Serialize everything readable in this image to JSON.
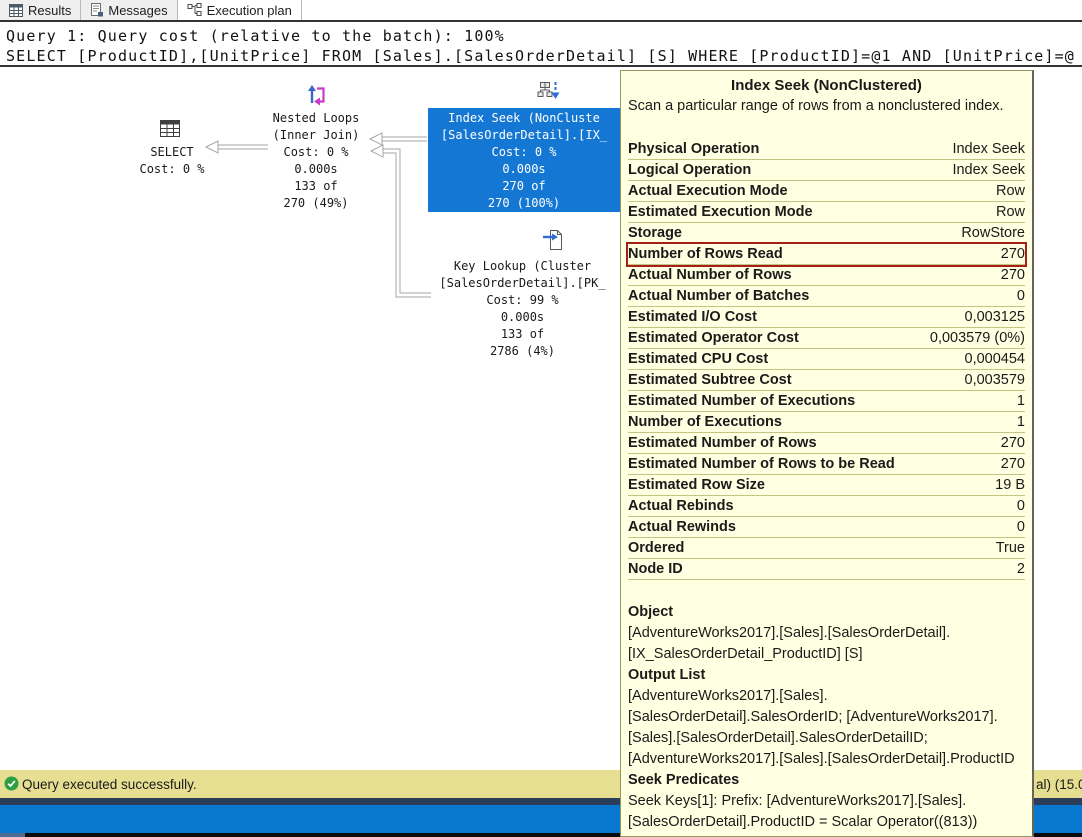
{
  "tabs": [
    {
      "label": "Results"
    },
    {
      "label": "Messages"
    },
    {
      "label": "Execution plan"
    }
  ],
  "query_header": {
    "line1": "Query 1: Query cost (relative to the batch): 100%",
    "line2": "SELECT [ProductID],[UnitPrice] FROM [Sales].[SalesOrderDetail] [S] WHERE [ProductID]=@1 AND [UnitPrice]=@"
  },
  "plan": {
    "nodes": {
      "select": {
        "lines": [
          "SELECT",
          "Cost: 0 %"
        ]
      },
      "nested_loops": {
        "lines": [
          "Nested Loops",
          "(Inner Join)",
          "Cost: 0 %",
          "0.000s",
          "133 of",
          "270 (49%)"
        ]
      },
      "index_seek": {
        "lines": [
          "Index Seek (NonCluste",
          "[SalesOrderDetail].[IX_",
          "Cost: 0 %",
          "0.000s",
          "270 of",
          "270 (100%)"
        ]
      },
      "key_lookup": {
        "lines": [
          "Key Lookup (Cluster",
          "[SalesOrderDetail].[PK_",
          "Cost: 99 %",
          "0.000s",
          "133 of",
          "2786 (4%)"
        ]
      }
    }
  },
  "tooltip": {
    "title": "Index Seek (NonClustered)",
    "description": "Scan a particular range of rows from a nonclustered index.",
    "rows": [
      {
        "label": "Physical Operation",
        "value": "Index Seek"
      },
      {
        "label": "Logical Operation",
        "value": "Index Seek"
      },
      {
        "label": "Actual Execution Mode",
        "value": "Row"
      },
      {
        "label": "Estimated Execution Mode",
        "value": "Row"
      },
      {
        "label": "Storage",
        "value": "RowStore"
      },
      {
        "label": "Number of Rows Read",
        "value": "270",
        "highlight": true
      },
      {
        "label": "Actual Number of Rows",
        "value": "270"
      },
      {
        "label": "Actual Number of Batches",
        "value": "0"
      },
      {
        "label": "Estimated I/O Cost",
        "value": "0,003125"
      },
      {
        "label": "Estimated Operator Cost",
        "value": "0,003579 (0%)"
      },
      {
        "label": "Estimated CPU Cost",
        "value": "0,000454"
      },
      {
        "label": "Estimated Subtree Cost",
        "value": "0,003579"
      },
      {
        "label": "Estimated Number of Executions",
        "value": "1"
      },
      {
        "label": "Number of Executions",
        "value": "1"
      },
      {
        "label": "Estimated Number of Rows",
        "value": "270"
      },
      {
        "label": "Estimated Number of Rows to be Read",
        "value": "270"
      },
      {
        "label": "Estimated Row Size",
        "value": "19 B"
      },
      {
        "label": "Actual Rebinds",
        "value": "0"
      },
      {
        "label": "Actual Rewinds",
        "value": "0"
      },
      {
        "label": "Ordered",
        "value": "True"
      },
      {
        "label": "Node ID",
        "value": "2"
      }
    ],
    "object_section": {
      "heading": "Object",
      "lines": [
        "[AdventureWorks2017].[Sales].[SalesOrderDetail].",
        "[IX_SalesOrderDetail_ProductID] [S]"
      ]
    },
    "output_list_section": {
      "heading": "Output List",
      "lines": [
        "[AdventureWorks2017].[Sales].",
        "[SalesOrderDetail].SalesOrderID; [AdventureWorks2017].",
        "[Sales].[SalesOrderDetail].SalesOrderDetailID;",
        "[AdventureWorks2017].[Sales].[SalesOrderDetail].ProductID"
      ]
    },
    "seek_predicates_section": {
      "heading": "Seek Predicates",
      "lines": [
        "Seek Keys[1]: Prefix: [AdventureWorks2017].[Sales].",
        "[SalesOrderDetail].ProductID = Scalar Operator((813))"
      ]
    }
  },
  "status_bar": {
    "message": "Query executed successfully.",
    "right_fragment": "al) (15.0"
  },
  "colors": {
    "selection_blue": "#1577D4",
    "tooltip_bg": "#FFFFE1",
    "highlight_red": "#A52019",
    "status_yellow": "#E6DF92",
    "status_navy": "#2B3D59",
    "status_blue": "#0878CE",
    "success_green": "#2E9E44"
  }
}
